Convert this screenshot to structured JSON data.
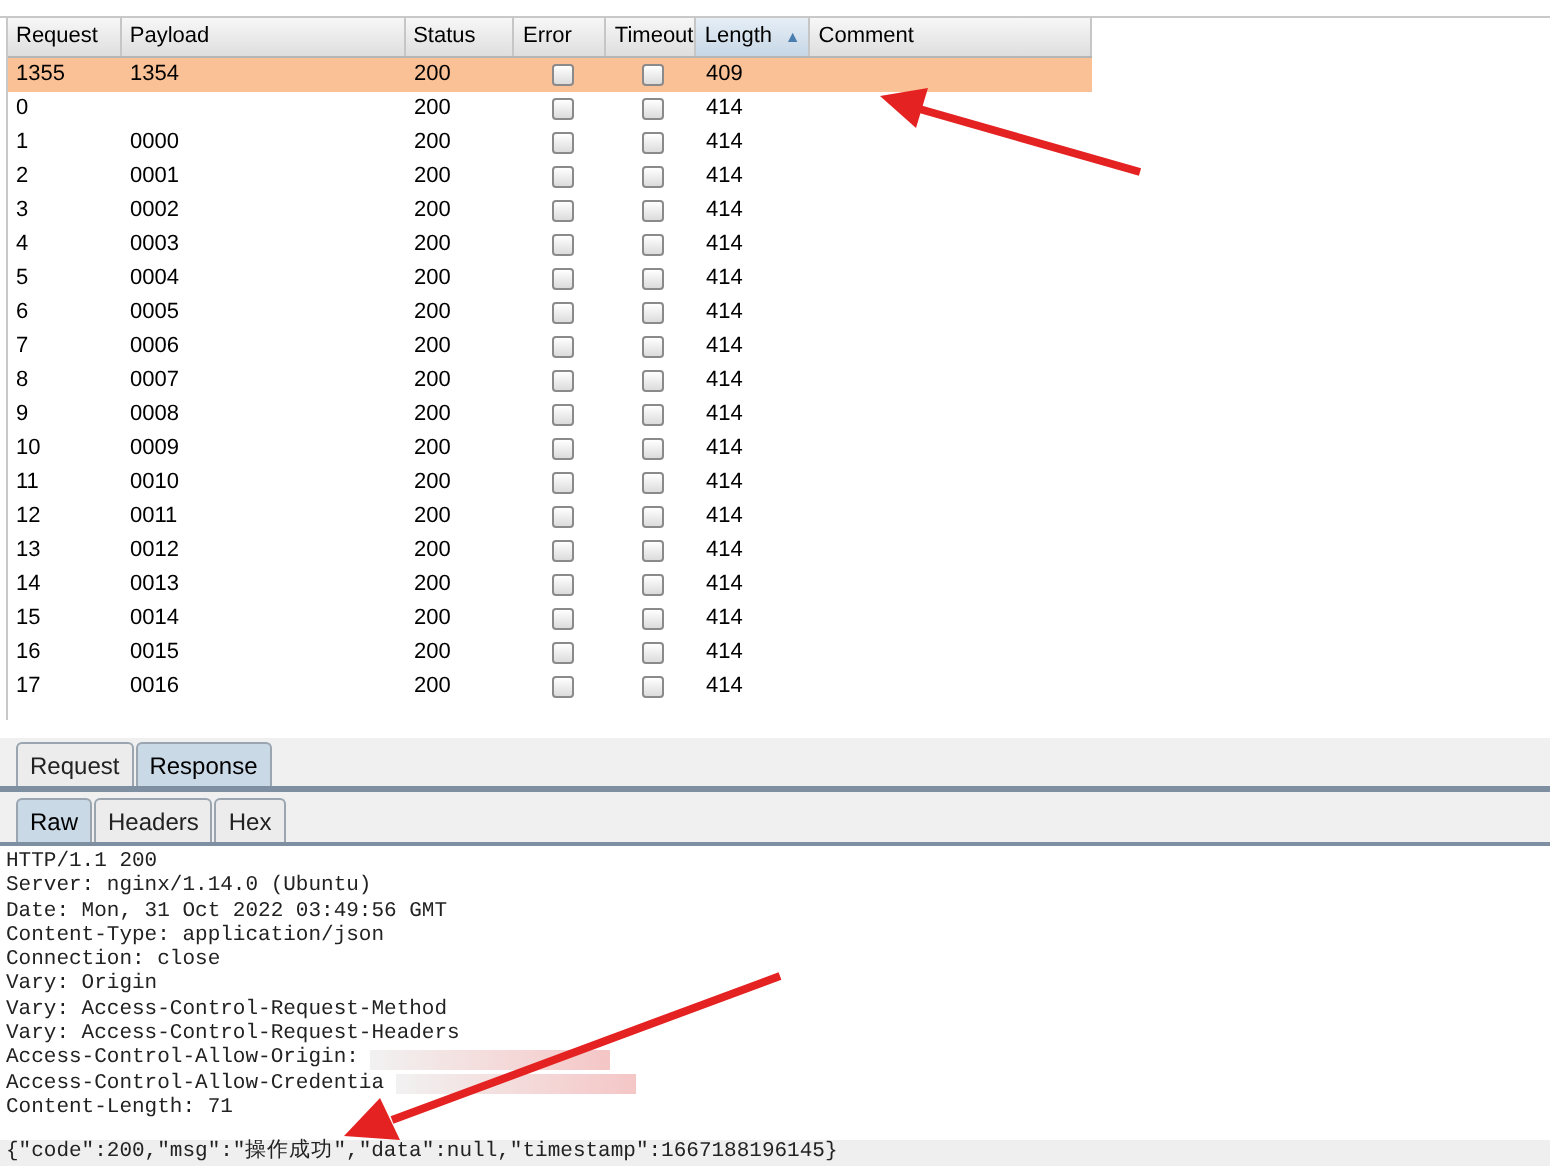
{
  "table": {
    "columns": [
      {
        "label": "Request",
        "sorted": false
      },
      {
        "label": "Payload",
        "sorted": false
      },
      {
        "label": "Status",
        "sorted": false
      },
      {
        "label": "Error",
        "sorted": false
      },
      {
        "label": "Timeout",
        "sorted": false
      },
      {
        "label": "Length",
        "sorted": true,
        "sort_icon": "▲"
      },
      {
        "label": "Comment",
        "sorted": false
      }
    ],
    "rows": [
      {
        "request": "1355",
        "payload": "1354",
        "status": "200",
        "error": false,
        "timeout": false,
        "length": "409",
        "selected": true
      },
      {
        "request": "0",
        "status": "200",
        "error": false,
        "timeout": false,
        "length": "414",
        "selected": false
      },
      {
        "request": "1",
        "payload": "0000",
        "status": "200",
        "error": false,
        "timeout": false,
        "length": "414",
        "selected": false
      },
      {
        "request": "2",
        "payload": "0001",
        "status": "200",
        "error": false,
        "timeout": false,
        "length": "414",
        "selected": false
      },
      {
        "request": "3",
        "payload": "0002",
        "status": "200",
        "error": false,
        "timeout": false,
        "length": "414",
        "selected": false
      },
      {
        "request": "4",
        "payload": "0003",
        "status": "200",
        "error": false,
        "timeout": false,
        "length": "414",
        "selected": false
      },
      {
        "request": "5",
        "payload": "0004",
        "status": "200",
        "error": false,
        "timeout": false,
        "length": "414",
        "selected": false
      },
      {
        "request": "6",
        "payload": "0005",
        "status": "200",
        "error": false,
        "timeout": false,
        "length": "414",
        "selected": false
      },
      {
        "request": "7",
        "payload": "0006",
        "status": "200",
        "error": false,
        "timeout": false,
        "length": "414",
        "selected": false
      },
      {
        "request": "8",
        "payload": "0007",
        "status": "200",
        "error": false,
        "timeout": false,
        "length": "414",
        "selected": false
      },
      {
        "request": "9",
        "payload": "0008",
        "status": "200",
        "error": false,
        "timeout": false,
        "length": "414",
        "selected": false
      },
      {
        "request": "10",
        "payload": "0009",
        "status": "200",
        "error": false,
        "timeout": false,
        "length": "414",
        "selected": false
      },
      {
        "request": "11",
        "payload": "0010",
        "status": "200",
        "error": false,
        "timeout": false,
        "length": "414",
        "selected": false
      },
      {
        "request": "12",
        "payload": "0011",
        "status": "200",
        "error": false,
        "timeout": false,
        "length": "414",
        "selected": false
      },
      {
        "request": "13",
        "payload": "0012",
        "status": "200",
        "error": false,
        "timeout": false,
        "length": "414",
        "selected": false
      },
      {
        "request": "14",
        "payload": "0013",
        "status": "200",
        "error": false,
        "timeout": false,
        "length": "414",
        "selected": false
      },
      {
        "request": "15",
        "payload": "0014",
        "status": "200",
        "error": false,
        "timeout": false,
        "length": "414",
        "selected": false
      },
      {
        "request": "16",
        "payload": "0015",
        "status": "200",
        "error": false,
        "timeout": false,
        "length": "414",
        "selected": false
      },
      {
        "request": "17",
        "payload": "0016",
        "status": "200",
        "error": false,
        "timeout": false,
        "length": "414",
        "selected": false
      }
    ]
  },
  "message_tabs": [
    {
      "label": "Request",
      "selected": false
    },
    {
      "label": "Response",
      "selected": true
    }
  ],
  "view_tabs": [
    {
      "label": "Raw",
      "selected": true
    },
    {
      "label": "Headers",
      "selected": false
    },
    {
      "label": "Hex",
      "selected": false
    }
  ],
  "response": {
    "headers": [
      "HTTP/1.1 200",
      "Server: nginx/1.14.0 (Ubuntu)",
      "Date: Mon, 31 Oct 2022 03:49:56 GMT",
      "Content-Type: application/json",
      "Connection: close",
      "Vary: Origin",
      "Vary: Access-Control-Request-Method",
      "Vary: Access-Control-Request-Headers",
      "Access-Control-Allow-Origin:",
      "Access-Control-Allow-Credentia",
      "Content-Length: 71"
    ],
    "body": "{\"code\":200,\"msg\":\"操作成功\",\"data\":null,\"timestamp\":1667188196145}"
  }
}
